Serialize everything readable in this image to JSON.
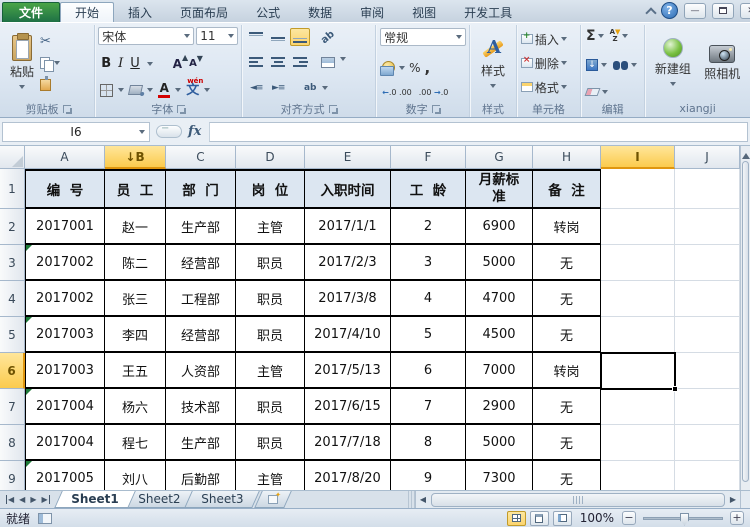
{
  "titlebar": {
    "file_tab": "文件",
    "tabs": [
      "开始",
      "插入",
      "页面布局",
      "公式",
      "数据",
      "审阅",
      "视图",
      "开发工具"
    ],
    "active_tab": "开始"
  },
  "ribbon": {
    "clipboard": {
      "label": "剪贴板",
      "paste": "粘贴"
    },
    "font": {
      "label": "字体",
      "font_name": "宋体",
      "font_size": "11",
      "bold": "B",
      "italic": "I",
      "underline": "U",
      "grow": "A",
      "shrink": "A",
      "color_letter": "A",
      "wen": "文"
    },
    "alignment": {
      "label": "对齐方式",
      "orientation": "ab",
      "wrap": "ab"
    },
    "number": {
      "label": "数字",
      "format": "常规",
      "percent": "%",
      "comma": ",",
      "inc_decimal": ".0",
      "dec_decimal": ".00"
    },
    "styles": {
      "label": "样式",
      "button": "样式",
      "letter": "A"
    },
    "cells": {
      "label": "单元格",
      "insert": "插入",
      "delete": "删除",
      "format": "格式"
    },
    "editing": {
      "label": "编辑",
      "sigma": "Σ",
      "sort_a": "A",
      "sort_z": "Z"
    },
    "xiangji": {
      "label": "xiangji",
      "new_group": "新建组",
      "camera": "照相机"
    }
  },
  "formula_bar": {
    "name_box": "I6",
    "fx": "fx",
    "formula": ""
  },
  "grid": {
    "column_letters": [
      "A",
      "B",
      "C",
      "D",
      "E",
      "F",
      "G",
      "H",
      "I",
      "J"
    ],
    "hover_column": "B",
    "hover_arrow": "↓",
    "selected_column": "I",
    "row_numbers": [
      "1",
      "2",
      "3",
      "4",
      "5",
      "6",
      "7",
      "8",
      "9"
    ],
    "selected_row": "6",
    "selected_cell": "I6"
  },
  "table": {
    "headers": [
      "编  号",
      "员  工",
      "部  门",
      "岗  位",
      "入职时间",
      "工  龄",
      "月薪标准",
      "备  注"
    ],
    "rows": [
      [
        "2017001",
        "赵一",
        "生产部",
        "主管",
        "2017/1/1",
        "2",
        "6900",
        "转岗"
      ],
      [
        "2017002",
        "陈二",
        "经营部",
        "职员",
        "2017/2/3",
        "3",
        "5000",
        "无"
      ],
      [
        "2017002",
        "张三",
        "工程部",
        "职员",
        "2017/3/8",
        "4",
        "4700",
        "无"
      ],
      [
        "2017003",
        "李四",
        "经营部",
        "职员",
        "2017/4/10",
        "5",
        "4500",
        "无"
      ],
      [
        "2017003",
        "王五",
        "人资部",
        "主管",
        "2017/5/13",
        "6",
        "7000",
        "转岗"
      ],
      [
        "2017004",
        "杨六",
        "技术部",
        "职员",
        "2017/6/15",
        "7",
        "2900",
        "无"
      ],
      [
        "2017004",
        "程七",
        "生产部",
        "职员",
        "2017/7/18",
        "8",
        "5000",
        "无"
      ],
      [
        "2017005",
        "刘八",
        "后勤部",
        "主管",
        "2017/8/20",
        "9",
        "7300",
        "无"
      ]
    ],
    "error_marker_rows": [
      3,
      5,
      7,
      9
    ]
  },
  "sheet_bar": {
    "sheets": [
      "Sheet1",
      "Sheet2",
      "Sheet3"
    ],
    "active_sheet": "Sheet1"
  },
  "status_bar": {
    "ready": "就绪",
    "zoom_level": "100%"
  }
}
